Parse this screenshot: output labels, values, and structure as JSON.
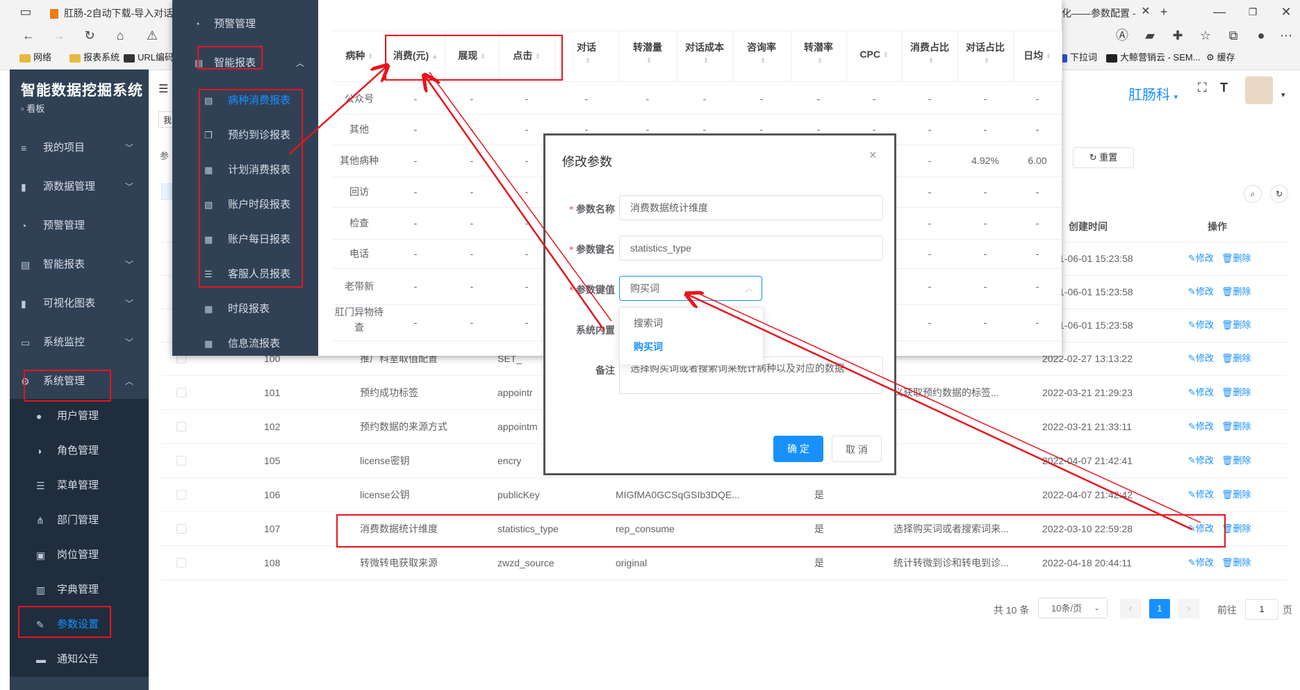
{
  "browser": {
    "tab_left": "肛肠-2自动下载-导入对话数",
    "tab_right": "化——参数配置 -",
    "new_tab": "+",
    "bookmarks_left": [
      "网络",
      "报表系统",
      "URL编码"
    ],
    "bookmarks_right": [
      "下拉词",
      "大鲸营销云 - SEM...",
      "缓存"
    ]
  },
  "app": {
    "title": "智能数据挖掘系统",
    "subtitle": "看板",
    "user_name": "肛肠科"
  },
  "sidebar": {
    "items": [
      {
        "label": "我的项目",
        "icon": "layers-icon"
      },
      {
        "label": "源数据管理",
        "icon": "bar-chart-icon"
      },
      {
        "label": "预警管理",
        "icon": "dashboard-icon"
      },
      {
        "label": "智能报表",
        "icon": "book-icon"
      },
      {
        "label": "可视化图表",
        "icon": "bar-chart-icon"
      },
      {
        "label": "系统监控",
        "icon": "monitor-icon"
      },
      {
        "label": "系统管理",
        "icon": "gear-icon"
      }
    ],
    "sub_items": [
      {
        "label": "用户管理",
        "icon": "user-icon"
      },
      {
        "label": "角色管理",
        "icon": "peoples-icon"
      },
      {
        "label": "菜单管理",
        "icon": "list-icon"
      },
      {
        "label": "部门管理",
        "icon": "tree-icon"
      },
      {
        "label": "岗位管理",
        "icon": "post-icon"
      },
      {
        "label": "字典管理",
        "icon": "dict-icon"
      },
      {
        "label": "参数设置",
        "icon": "edit-icon"
      },
      {
        "label": "通知公告",
        "icon": "message-icon"
      }
    ]
  },
  "main": {
    "breadcrumb_hint": "参",
    "search_hint": "我",
    "reset_label": "重置",
    "table_headers": {
      "created": "创建时间",
      "ops": "操作"
    },
    "rows_top": [
      {
        "time": "1-06-01 15:23:58"
      },
      {
        "time": "1-06-01 15:23:58"
      },
      {
        "time": "1-06-01 15:23:58"
      }
    ],
    "rows": [
      {
        "id": "100",
        "name": "推广科室取值配置",
        "key": "SET_",
        "value": "",
        "builtin": "",
        "remark": "",
        "time": "2022-02-27 13:13:22"
      },
      {
        "id": "101",
        "name": "预约成功标签",
        "key": "appointr",
        "value": "",
        "builtin": "",
        "remark": "义获取预约数据的标签...",
        "time": "2022-03-21 21:29:23"
      },
      {
        "id": "102",
        "name": "预约数据的来源方式",
        "key": "appointm",
        "value": "",
        "builtin": "",
        "remark": "",
        "time": "2022-03-21 21:33:11"
      },
      {
        "id": "105",
        "name": "license密钥",
        "key": "encry",
        "value": "",
        "builtin": "",
        "remark": "",
        "time": "2022-04-07 21:42:41"
      },
      {
        "id": "106",
        "name": "license公钥",
        "key": "publicKey",
        "value": "MIGfMA0GCSqGSIb3DQE...",
        "builtin": "是",
        "remark": "",
        "time": "2022-04-07 21:42:42"
      },
      {
        "id": "107",
        "name": "消费数据统计维度",
        "key": "statistics_type",
        "value": "rep_consume",
        "builtin": "是",
        "remark": "选择购买词或者搜索词来...",
        "time": "2022-03-10 22:59:28"
      },
      {
        "id": "108",
        "name": "转微转电获取来源",
        "key": "zwzd_source",
        "value": "original",
        "builtin": "是",
        "remark": "统计转微到诊和转电到诊...",
        "time": "2022-04-18 20:44:11"
      }
    ],
    "edit_label": "修改",
    "delete_label": "删除",
    "pagination": {
      "total": "共 10 条",
      "page_size": "10条/页",
      "current": "1",
      "goto_prefix": "前往",
      "goto_value": "1",
      "goto_suffix": "页"
    }
  },
  "report_window": {
    "menu": [
      {
        "label": "预警管理",
        "icon": "dashboard-icon"
      },
      {
        "label": "智能报表",
        "icon": "book-icon"
      },
      {
        "label": "病种消费报表",
        "icon": "doc-icon"
      },
      {
        "label": "预约到诊报表",
        "icon": "copy-icon"
      },
      {
        "label": "计划消费报表",
        "icon": "table-icon"
      },
      {
        "label": "账户时段报表",
        "icon": "calendar-icon"
      },
      {
        "label": "账户每日报表",
        "icon": "grid-icon"
      },
      {
        "label": "客服人员报表",
        "icon": "list-icon"
      },
      {
        "label": "时段报表",
        "icon": "table-icon"
      },
      {
        "label": "信息流报表",
        "icon": "table-icon"
      }
    ],
    "headers": [
      "病种",
      "消费(元)",
      "展现",
      "点击",
      "对话",
      "转潜量",
      "对话成本",
      "咨询率",
      "转潜率",
      "CPC",
      "消费占比",
      "对话占比",
      "日均"
    ],
    "rows": [
      {
        "name": "公众号",
        "cells": [
          "-",
          "-",
          "-",
          "-",
          "-",
          "-",
          "-",
          "-",
          "-",
          "-",
          "-",
          "-"
        ]
      },
      {
        "name": "其他",
        "cells": [
          "-",
          "-",
          "-",
          "-",
          "-",
          "-",
          "-",
          "-",
          "-",
          "-",
          "-",
          "-"
        ]
      },
      {
        "name": "其他病种",
        "cells": [
          "-",
          "-",
          "-",
          "-",
          "-",
          "-",
          "-",
          "-",
          "-",
          "-",
          "4.92%",
          "6.00"
        ]
      },
      {
        "name": "回访",
        "cells": [
          "-",
          "-",
          "-",
          "-",
          "-",
          "-",
          "-",
          "-",
          "-",
          "-",
          "-",
          "-"
        ]
      },
      {
        "name": "检查",
        "cells": [
          "-",
          "-",
          "-",
          "-",
          "-",
          "-",
          "-",
          "-",
          "-",
          "-",
          "-",
          "-"
        ]
      },
      {
        "name": "电话",
        "cells": [
          "-",
          "-",
          "-",
          "-",
          "-",
          "-",
          "-",
          "-",
          "-",
          "-",
          "-",
          "-"
        ]
      },
      {
        "name": "老带新",
        "cells": [
          "-",
          "-",
          "-",
          "-",
          "-",
          "-",
          "-",
          "-",
          "-",
          "-",
          "-",
          "-"
        ]
      },
      {
        "name": "肛门异物待查",
        "cells": [
          "-",
          "-",
          "-",
          "-",
          "-",
          "-",
          "-",
          "-",
          "-",
          "-",
          "-",
          "-"
        ]
      }
    ]
  },
  "dialog": {
    "title": "修改参数",
    "close": "×",
    "fields": {
      "name_label": "参数名称",
      "name_value": "消费数据统计维度",
      "key_label": "参数键名",
      "key_value": "statistics_type",
      "val_label": "参数键值",
      "val_value": "购买词",
      "builtin_label": "系统内置",
      "remark_label": "备注",
      "remark_value": "选择购买词或者搜索词来统计病种以及对应的数据"
    },
    "dropdown_options": [
      "搜索词",
      "购买词"
    ],
    "confirm": "确 定",
    "cancel": "取 消"
  },
  "colors": {
    "sidebar": "#304156",
    "accent": "#1890ff",
    "annotation": "#e8141d"
  }
}
